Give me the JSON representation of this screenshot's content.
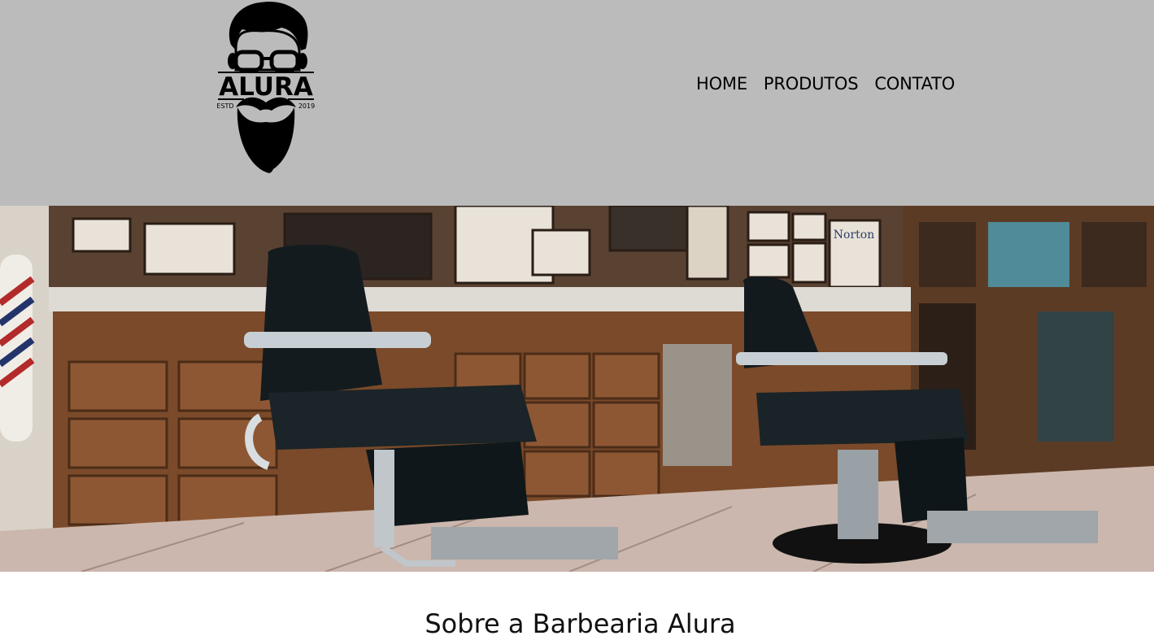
{
  "logo": {
    "wordmark": "ALURA",
    "estd_left": "ESTD",
    "estd_right": "2019",
    "icon": "bearded-man-icon"
  },
  "nav": {
    "items": [
      "HOME",
      "PRODUTOS",
      "CONTATO"
    ]
  },
  "hero": {
    "sign_text": "Norton"
  },
  "about": {
    "title": "Sobre a Barbearia Alura"
  },
  "colors": {
    "header_bg": "#bbbbbb",
    "text": "#000000"
  }
}
